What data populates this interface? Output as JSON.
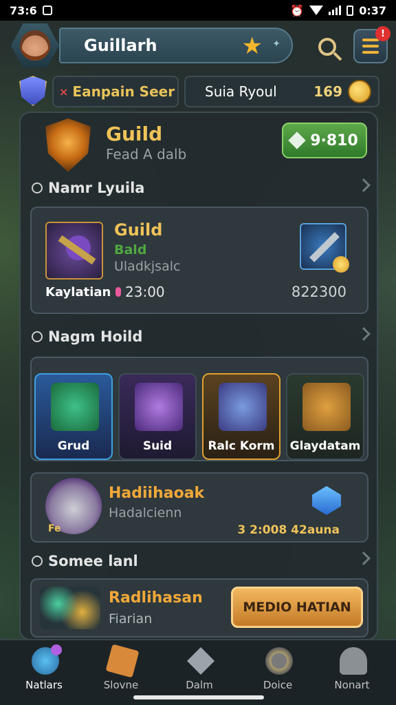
{
  "status_bar": {
    "left_text": "73:6",
    "time": "0:37"
  },
  "header": {
    "player_name": "Guillarh"
  },
  "currency_row": {
    "event_label": "Eanpain Seer",
    "event_marker": "×",
    "resource_label": "Suia Ryoul",
    "resource_amount": "169"
  },
  "guild": {
    "title": "Guild",
    "subtitle": "Fead A dalb",
    "action_amount": "9·810",
    "section1_title": "Namr Lyuila",
    "card1": {
      "title": "Guild",
      "sub1": "Bald",
      "sub2": "Uladkjsalc",
      "item_label": "Kaylatian",
      "price": "23:00",
      "right_value": "822300"
    },
    "section2_title": "Nagm Hoild",
    "tiles": [
      {
        "label": "Grud"
      },
      {
        "label": "Suid"
      },
      {
        "label": "Ralc Korm"
      },
      {
        "label": "Glaydatam"
      }
    ],
    "card3": {
      "title": "Hadiihaoak",
      "sub": "Hadalcienn",
      "tag": "Fe",
      "price": "3 2:008 42auna"
    },
    "section3_title": "Somee lanl",
    "card4": {
      "title": "Radlihasan",
      "sub": "Fiarian",
      "button_label": "MEDIO HATIAN"
    }
  },
  "nav": [
    {
      "label": "Natlars",
      "icon": "shield-swirl-icon"
    },
    {
      "label": "Slovne",
      "icon": "scroll-icon"
    },
    {
      "label": "Dalm",
      "icon": "sword-icon"
    },
    {
      "label": "Doice",
      "icon": "gear-icon"
    },
    {
      "label": "Nonart",
      "icon": "profile-icon"
    }
  ],
  "colors": {
    "accent_gold": "#f0c35a",
    "accent_green": "#4fa840",
    "badge_red": "#e03030",
    "panel_bg": "#232b2f"
  }
}
